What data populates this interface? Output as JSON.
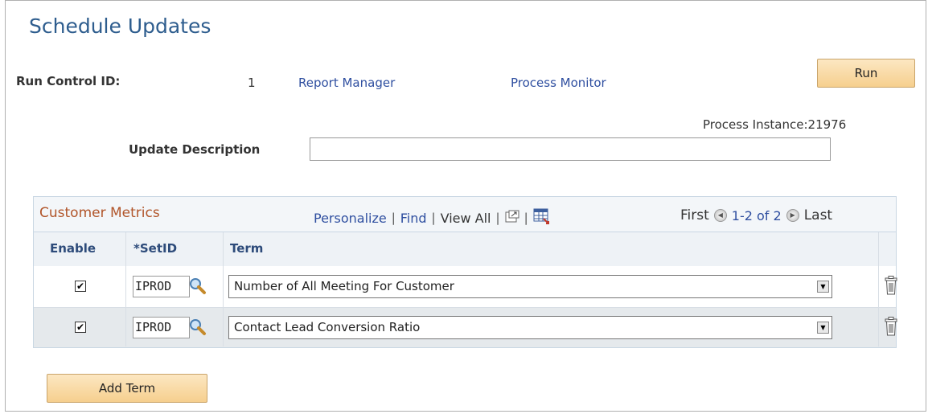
{
  "page": {
    "title": "Schedule Updates"
  },
  "run_control": {
    "label": "Run Control ID:",
    "value": "1",
    "report_manager": "Report Manager",
    "process_monitor": "Process Monitor",
    "run_label": "Run",
    "process_instance": "Process Instance:21976"
  },
  "update_description": {
    "label": "Update Description",
    "value": ""
  },
  "grid": {
    "title": "Customer Metrics",
    "personalize": "Personalize",
    "find": "Find",
    "view_all": "View All",
    "first": "First",
    "range": "1-2 of 2",
    "last": "Last",
    "columns": {
      "enable": "Enable",
      "setid": "*SetID",
      "term": "Term"
    },
    "rows": [
      {
        "enabled": "✔",
        "setid": "IPROD",
        "term": "Number of All Meeting For Customer"
      },
      {
        "enabled": "✔",
        "setid": "IPROD",
        "term": "Contact Lead Conversion Ratio"
      }
    ]
  },
  "add_term_label": "Add Term",
  "icons": {
    "lookup": "magnifier-icon",
    "delete": "trash-icon",
    "new_window": "new-window-icon",
    "download": "spreadsheet-download-icon",
    "prev": "prev-arrow-icon",
    "next": "next-arrow-icon"
  },
  "colors": {
    "title": "#2e5d8e",
    "link": "#2f4fa0",
    "grid_title": "#b1552a",
    "button": "#f6cf8e"
  }
}
